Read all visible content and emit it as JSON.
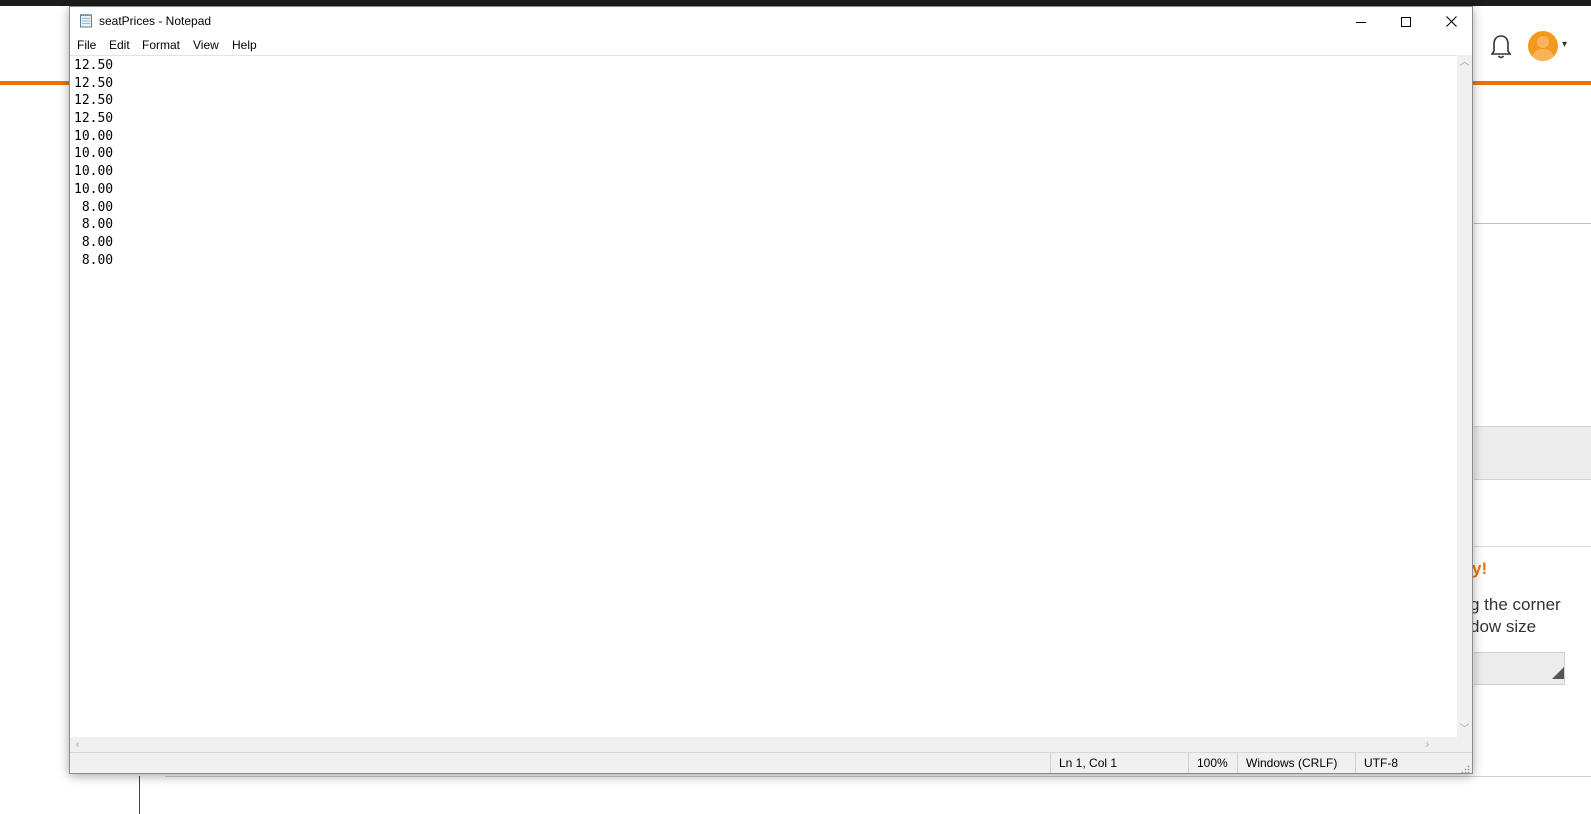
{
  "window": {
    "title": "seatPrices - Notepad",
    "controls": {
      "minimize": "minimize-icon",
      "maximize": "maximize-icon",
      "close": "close-icon"
    }
  },
  "menu": {
    "items": [
      {
        "label": "File"
      },
      {
        "label": "Edit"
      },
      {
        "label": "Format"
      },
      {
        "label": "View"
      },
      {
        "label": "Help"
      }
    ]
  },
  "editor": {
    "lines": [
      "12.50",
      "12.50",
      "12.50",
      "12.50",
      "10.00",
      "10.00",
      "10.00",
      "10.00",
      " 8.00",
      " 8.00",
      " 8.00",
      " 8.00"
    ]
  },
  "status": {
    "position": "Ln 1, Col 1",
    "zoom": "100%",
    "line_ending": "Windows (CRLF)",
    "encoding": "UTF-8"
  },
  "background": {
    "notice_heading": "y!",
    "notice_line1": "g the corner",
    "notice_line2": "dow size",
    "accent_color": "#e8740c"
  }
}
